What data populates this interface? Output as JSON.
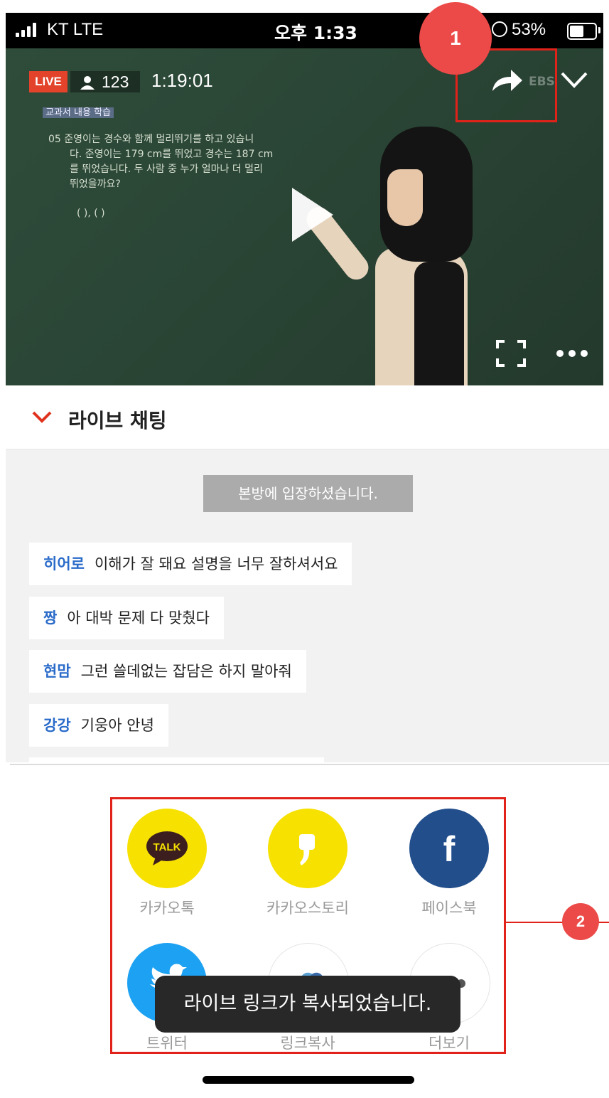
{
  "status_bar": {
    "carrier": "KT  LTE",
    "time": "오후 1:33",
    "battery": "53%"
  },
  "player": {
    "live_badge": "LIVE",
    "viewer_count": "123",
    "elapsed": "1:19:01",
    "watermark": "EBS",
    "board_lines": [
      "교과서 내용 학습",
      "05 준영이는 경수와 함께 멀리뛰기를 하고 있습니",
      "다. 준영이는 179 cm를 뛰었고 경수는 187 cm",
      "를 뛰었습니다. 두 사람 중 누가 얼마나 더 멀리",
      "뛰었을까요?",
      "(                ), (                )"
    ],
    "icons": {
      "share": "share-arrow-icon",
      "collapse": "chevron-down-icon",
      "play": "play-icon",
      "fullscreen": "fullscreen-icon",
      "more": "more-icon"
    }
  },
  "annotations": {
    "marker_1": "1",
    "marker_2": "2",
    "highlight_color": "#e0221a",
    "marker_color": "#ec4a48"
  },
  "chat": {
    "header_title": "라이브 채팅",
    "notice": "본방에 입장하셨습니다.",
    "messages": [
      {
        "nick": "히어로",
        "text": "이해가 잘 돼요 설명을 너무 잘하셔서요"
      },
      {
        "nick": "짱",
        "text": "아 대박 문제 다 맞췄다"
      },
      {
        "nick": "현맘",
        "text": "그런 쓸데없는 잡담은 하지 말아줘"
      },
      {
        "nick": "강강",
        "text": "기웅아 안녕"
      }
    ]
  },
  "share": {
    "items": [
      {
        "label": "카카오톡",
        "icon": "kakaotalk-icon",
        "glyph": "TALK",
        "color": "#f7e100"
      },
      {
        "label": "카카오스토리",
        "icon": "kakaostory-icon",
        "glyph": "❜",
        "color": "#f7e100"
      },
      {
        "label": "페이스북",
        "icon": "facebook-icon",
        "glyph": "f",
        "color": "#234e8c"
      },
      {
        "label": "트위터",
        "icon": "twitter-icon",
        "glyph": "",
        "color": "#1da1f2"
      },
      {
        "label": "링크복사",
        "icon": "link-copy-icon",
        "glyph": "",
        "color": "#ffffff"
      },
      {
        "label": "더보기",
        "icon": "more-icon",
        "glyph": "•••",
        "color": "#ffffff"
      }
    ],
    "toast": "라이브 링크가 복사되었습니다."
  }
}
